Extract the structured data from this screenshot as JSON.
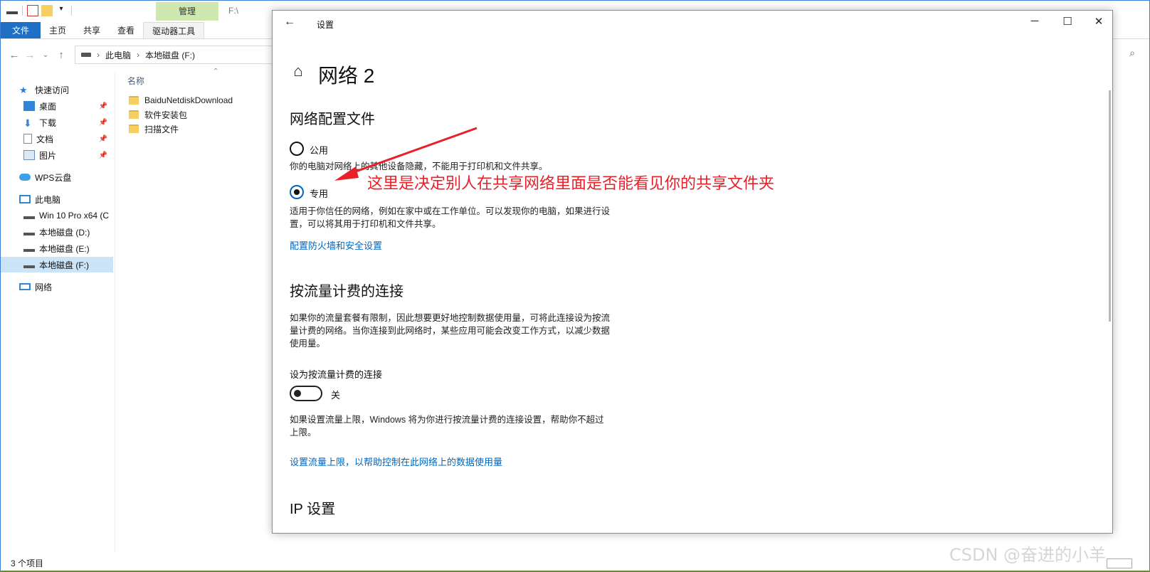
{
  "explorer": {
    "manage_tab": "管理",
    "title_path": "F:\\",
    "ribbon_tabs": [
      "文件",
      "主页",
      "共享",
      "查看",
      "驱动器工具"
    ],
    "breadcrumb": [
      "此电脑",
      "本地磁盘 (F:)"
    ],
    "nav": {
      "quick_access": "快速访问",
      "desktop": "桌面",
      "downloads": "下载",
      "documents": "文档",
      "pictures": "图片",
      "wps_cloud": "WPS云盘",
      "this_pc": "此电脑",
      "win10": "Win 10 Pro x64 (C",
      "disk_d": "本地磁盘 (D:)",
      "disk_e": "本地磁盘 (E:)",
      "disk_f": "本地磁盘 (F:)",
      "network": "网络"
    },
    "column_name": "名称",
    "files": [
      "BaiduNetdiskDownload",
      "软件安装包",
      "扫描文件"
    ],
    "status": "3 个项目"
  },
  "settings": {
    "window_title": "设置",
    "page_title": "网络 2",
    "section_profile": "网络配置文件",
    "public_label": "公用",
    "public_desc": "你的电脑对网络上的其他设备隐藏，不能用于打印机和文件共享。",
    "private_label": "专用",
    "private_desc": "适用于你信任的网络，例如在家中或在工作单位。可以发现你的电脑，如果进行设置，可以将其用于打印机和文件共享。",
    "firewall_link": "配置防火墙和安全设置",
    "section_metered": "按流量计费的连接",
    "metered_desc": "如果你的流量套餐有限制，因此想要更好地控制数据使用量，可将此连接设为按流量计费的网络。当你连接到此网络时，某些应用可能会改变工作方式，以减少数据使用量。",
    "metered_toggle_label": "设为按流量计费的连接",
    "metered_toggle_state": "关",
    "limit_desc": "如果设置流量上限，Windows 将为你进行按流量计费的连接设置，帮助你不超过上限。",
    "limit_link": "设置流量上限，以帮助控制在此网络上的数据使用量",
    "section_ip": "IP 设置",
    "selected_profile": "专用"
  },
  "annotation": "这里是决定别人在共享网络里面是否能看见你的共享文件夹",
  "watermark": "CSDN @奋进的小羊",
  "colors": {
    "accent": "#0067c0",
    "annotation": "#e8202a",
    "file_tab": "#1f6fc5",
    "manage_tab": "#cfe8b0",
    "selection": "#cce4f7"
  }
}
